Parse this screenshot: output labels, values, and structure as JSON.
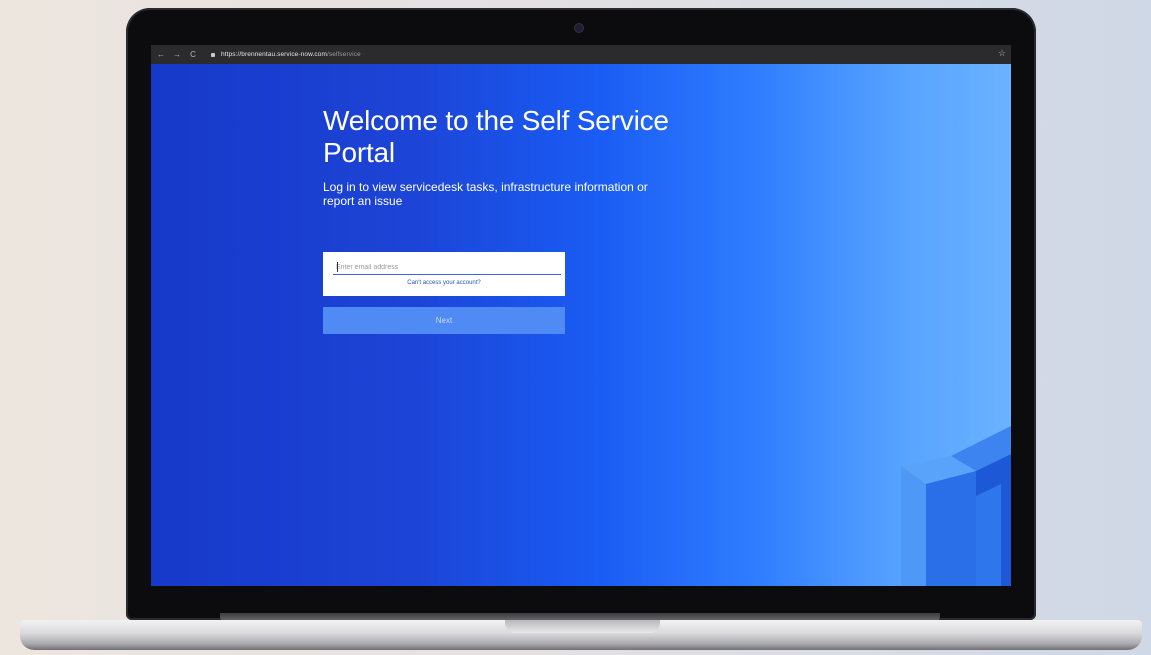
{
  "browser": {
    "back_icon": "←",
    "forward_icon": "→",
    "reload_icon": "C",
    "url_host": "https://brennentau.service-now.com",
    "url_path": "/selfservice",
    "bookmark_icon": "☆"
  },
  "page": {
    "title": "Welcome to the Self Service Portal",
    "subtitle": "Log in to view servicedesk tasks, infrastructure information or report an issue",
    "email_placeholder": "Enter email address",
    "email_value": "",
    "help_link": "Can't access your account?",
    "next_label": "Next"
  },
  "colors": {
    "page_gradient_start": "#1739c9",
    "page_gradient_end": "#6bb3ff",
    "next_button": "#4f8af5",
    "link": "#2452c9"
  }
}
